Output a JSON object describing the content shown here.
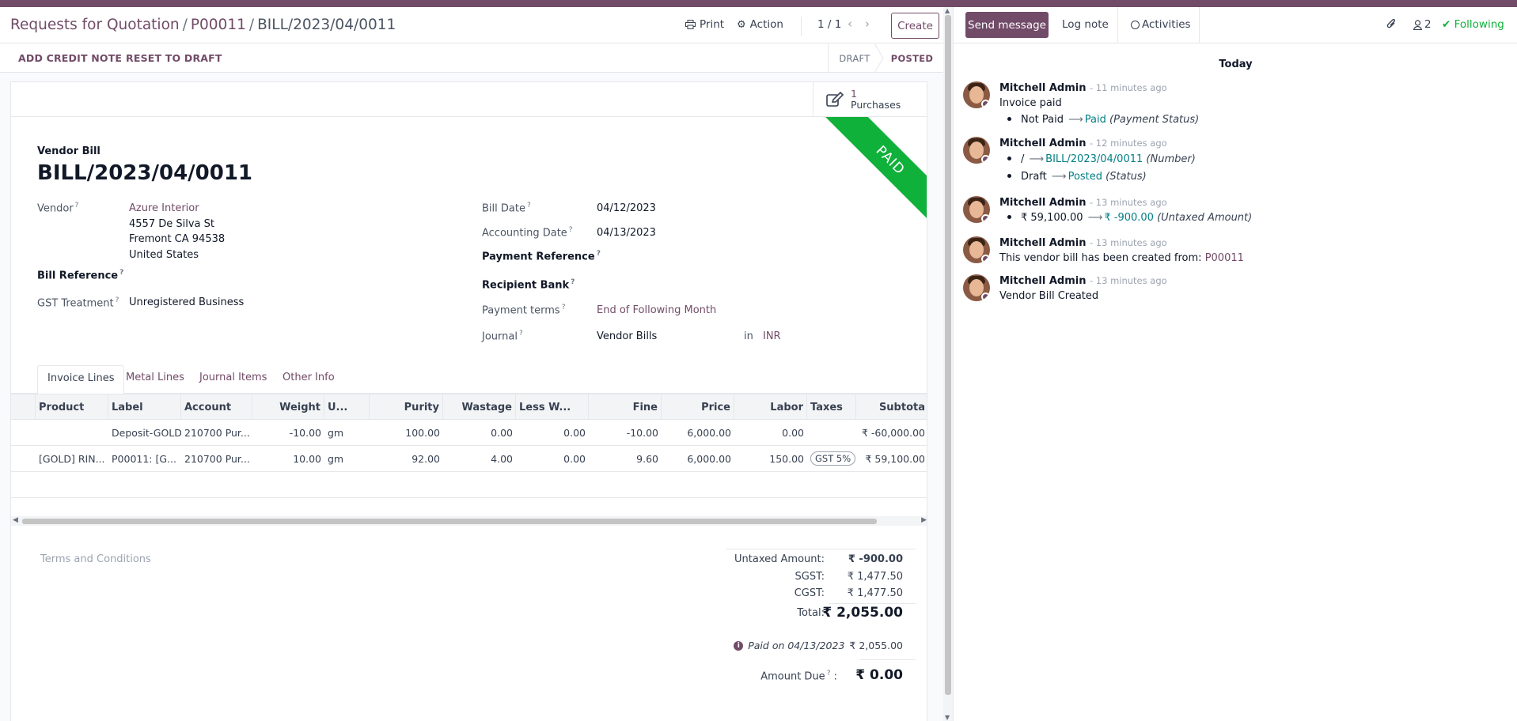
{
  "breadcrumb": {
    "root": "Requests for Quotation",
    "parent": "P00011",
    "current": "BILL/2023/04/0011"
  },
  "toolbar": {
    "print": "Print",
    "action": "Action",
    "pager": "1 / 1",
    "create": "Create"
  },
  "statusbar": {
    "buttons": {
      "credit_note": "ADD CREDIT NOTE",
      "reset": "RESET TO DRAFT"
    },
    "stages": {
      "draft": "DRAFT",
      "posted": "POSTED"
    }
  },
  "smart_button": {
    "count": "1",
    "label": "Purchases"
  },
  "ribbon": "PAID",
  "record": {
    "type_label": "Vendor Bill",
    "name": "BILL/2023/04/0011"
  },
  "fields": {
    "vendor": {
      "label": "Vendor",
      "name": "Azure Interior",
      "street": "4557 De Silva St",
      "city": "Fremont CA 94538",
      "country": "United States"
    },
    "bill_reference": {
      "label": "Bill Reference"
    },
    "gst_treatment": {
      "label": "GST Treatment",
      "value": "Unregistered Business"
    },
    "bill_date": {
      "label": "Bill Date",
      "value": "04/12/2023"
    },
    "accounting_date": {
      "label": "Accounting Date",
      "value": "04/13/2023"
    },
    "payment_reference": {
      "label": "Payment Reference"
    },
    "recipient_bank": {
      "label": "Recipient Bank"
    },
    "payment_terms": {
      "label": "Payment terms",
      "value": "End of Following Month"
    },
    "journal": {
      "label": "Journal",
      "value": "Vendor Bills",
      "in": "in",
      "currency": "INR"
    },
    "help_mark": "?"
  },
  "tabs": {
    "invoice_lines": "Invoice Lines",
    "metal_lines": "Metal Lines",
    "journal_items": "Journal Items",
    "other_info": "Other Info"
  },
  "table": {
    "headers": {
      "product": "Product",
      "label": "Label",
      "account": "Account",
      "weight": "Weight",
      "uom": "U...",
      "purity": "Purity",
      "wastage": "Wastage",
      "less_w": "Less W...",
      "fine": "Fine",
      "price": "Price",
      "labor": "Labor",
      "taxes": "Taxes",
      "subtotal": "Subtota"
    },
    "rows": [
      {
        "product": "",
        "label": "Deposit-GOLD",
        "account": "210700 Pur...",
        "weight": "-10.00",
        "uom": "gm",
        "purity": "100.00",
        "wastage": "0.00",
        "less_w": "0.00",
        "fine": "-10.00",
        "price": "6,000.00",
        "labor": "0.00",
        "taxes": "",
        "subtotal": "₹ -60,000.00"
      },
      {
        "product": "[GOLD] RIN...",
        "label": "P00011: [G...",
        "account": "210700 Pur...",
        "weight": "10.00",
        "uom": "gm",
        "purity": "92.00",
        "wastage": "4.00",
        "less_w": "0.00",
        "fine": "9.60",
        "price": "6,000.00",
        "labor": "150.00",
        "taxes": "GST 5%",
        "subtotal": "₹ 59,100.00"
      }
    ]
  },
  "terms_placeholder": "Terms and Conditions",
  "totals": {
    "untaxed_label": "Untaxed Amount:",
    "untaxed": "₹ -900.00",
    "sgst_label": "SGST:",
    "sgst": "₹ 1,477.50",
    "cgst_label": "CGST:",
    "cgst": "₹ 1,477.50",
    "total_label": "Total:",
    "total": "₹ 2,055.00",
    "paid_on": "Paid on 04/13/2023",
    "paid_amount": "₹ 2,055.00",
    "amount_due_label": "Amount Due",
    "amount_due_colon": ":",
    "amount_due": "₹ 0.00"
  },
  "chatter": {
    "send_message": "Send message",
    "log_note": "Log note",
    "activities": "Activities",
    "followers": "2",
    "following": "Following",
    "day": "Today",
    "messages": [
      {
        "author": "Mitchell Admin",
        "time": "- 11 minutes ago",
        "body": "Invoice paid",
        "old": "Not Paid",
        "new": "Paid",
        "field": "(Payment Status)"
      },
      {
        "author": "Mitchell Admin",
        "time": "- 12 minutes ago",
        "old1": "/",
        "new1": "BILL/2023/04/0011",
        "field1": "(Number)",
        "old2": "Draft",
        "new2": "Posted",
        "field2": "(Status)"
      },
      {
        "author": "Mitchell Admin",
        "time": "- 13 minutes ago",
        "old": "₹ 59,100.00",
        "new": "₹ -900.00",
        "field": "(Untaxed Amount)"
      },
      {
        "author": "Mitchell Admin",
        "time": "- 13 minutes ago",
        "body": "This vendor bill has been created from:",
        "link": "P00011"
      },
      {
        "author": "Mitchell Admin",
        "time": "- 13 minutes ago",
        "body": "Vendor Bill Created"
      }
    ]
  }
}
